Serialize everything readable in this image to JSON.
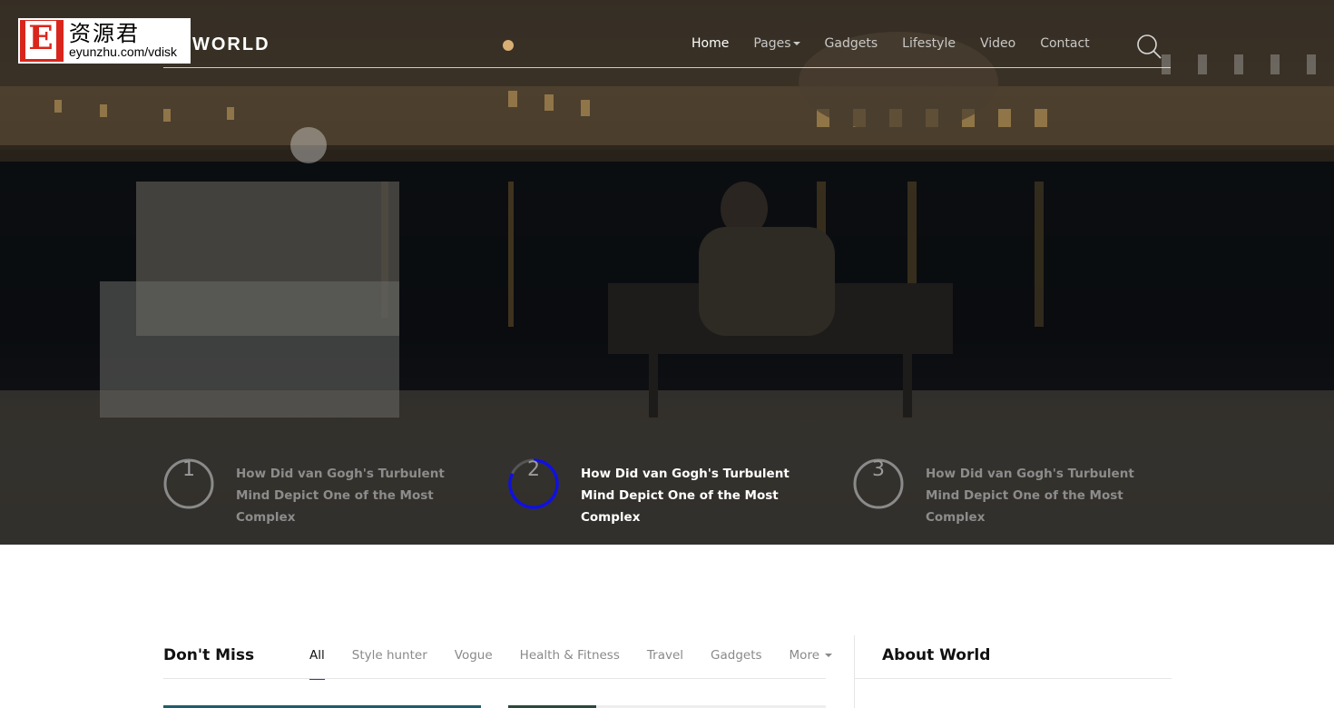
{
  "watermark": {
    "cn_text": "资源君",
    "url_text": "eyunzhu.com/vdisk"
  },
  "header": {
    "logo": "WORLD",
    "nav": [
      {
        "label": "Home",
        "active": true
      },
      {
        "label": "Pages",
        "dropdown": true
      },
      {
        "label": "Gadgets"
      },
      {
        "label": "Lifestyle"
      },
      {
        "label": "Video"
      },
      {
        "label": "Contact"
      }
    ],
    "search_icon": "search-icon"
  },
  "hero": {
    "slides": [
      {
        "number": "1",
        "title": "How Did van Gogh's Turbulent Mind Depict One of the Most Complex",
        "active": false,
        "progress": 0
      },
      {
        "number": "2",
        "title": "How Did van Gogh's Turbulent Mind Depict One of the Most Complex",
        "active": true,
        "progress": 0.82
      },
      {
        "number": "3",
        "title": "How Did van Gogh's Turbulent Mind Depict One of the Most Complex",
        "active": false,
        "progress": 0
      }
    ]
  },
  "dont_miss": {
    "title": "Don't Miss",
    "tabs": [
      "All",
      "Style hunter",
      "Vogue",
      "Health & Fitness",
      "Travel",
      "Gadgets",
      "More"
    ]
  },
  "sidebar": {
    "about_title": "About World"
  },
  "colors": {
    "accent": "#2a32d6",
    "progress_ring": "#1010e0"
  }
}
